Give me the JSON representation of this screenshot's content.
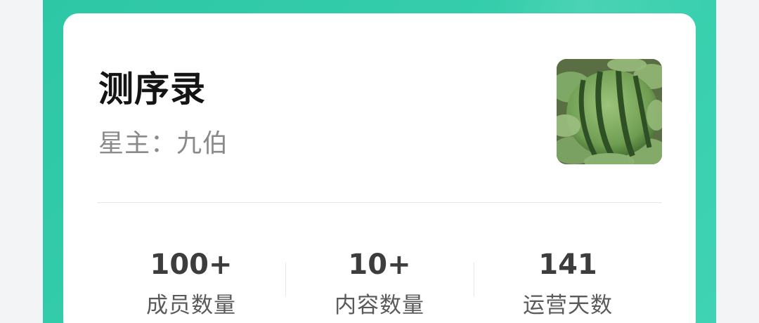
{
  "card": {
    "title": "测序录",
    "owner": "星主：九伯",
    "thumbnail": "watermelon-photo"
  },
  "stats": [
    {
      "value": "100+",
      "label": "成员数量"
    },
    {
      "value": "10+",
      "label": "内容数量"
    },
    {
      "value": "141",
      "label": "运营天数"
    }
  ],
  "colors": {
    "frame_green": "#2ec7a6",
    "card_background": "#ffffff",
    "page_background": "#f3f4f6"
  }
}
